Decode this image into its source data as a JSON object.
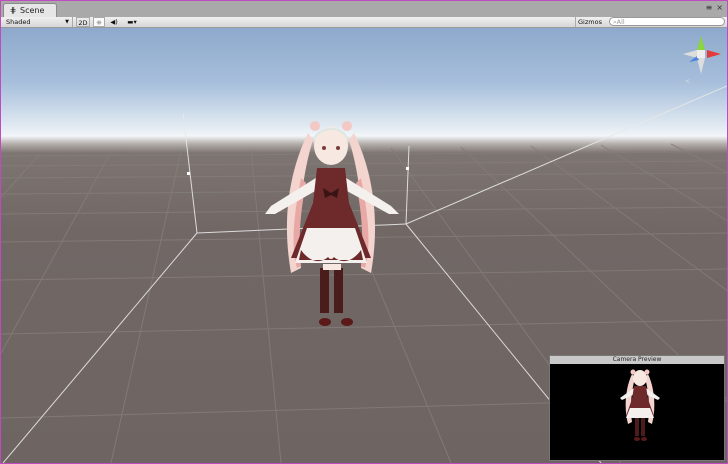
{
  "tab": {
    "label": "Scene",
    "icon": "scene-grid-icon"
  },
  "window_controls": {
    "menu": "≡",
    "close": "×"
  },
  "toolbar": {
    "draw_mode": "Shaded",
    "mode_2d": "2D",
    "gizmos": "Gizmos",
    "search_placeholder": "All"
  },
  "camera_preview": {
    "title": "Camera Preview"
  },
  "colors": {
    "frame_border": "#c04bc0",
    "axis_x": "#e33b3b",
    "axis_y": "#8bd63b",
    "axis_z": "#3b74e3",
    "dress": "#6e2a2a",
    "hair": "#f3d8d4"
  }
}
